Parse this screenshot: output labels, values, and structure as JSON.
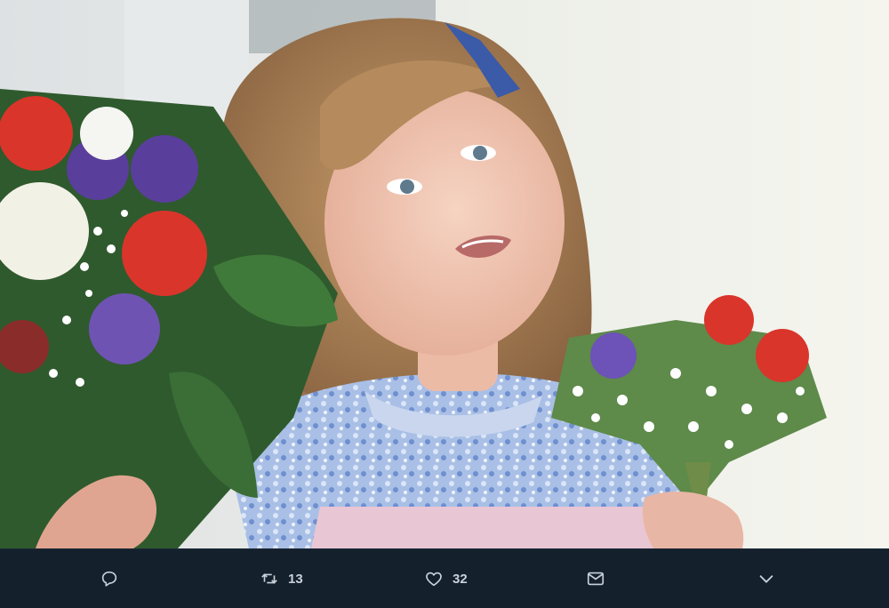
{
  "tweet": {
    "image": {
      "alt": ""
    },
    "actions": {
      "reply": {
        "icon": "reply-icon"
      },
      "retweet": {
        "icon": "retweet-icon",
        "count": "13"
      },
      "like": {
        "icon": "heart-icon",
        "count": "32"
      },
      "dm": {
        "icon": "envelope-icon"
      },
      "more": {
        "icon": "chevron-down-icon"
      }
    }
  },
  "colors": {
    "bar_background": "#14202c",
    "icon_color": "#c9d2da"
  }
}
